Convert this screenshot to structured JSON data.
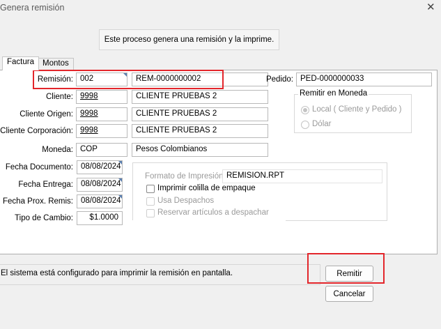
{
  "window": {
    "title": "Genera remisión",
    "close": "✕"
  },
  "info_message": "Este proceso genera una remisión y la imprime.",
  "tabs": [
    {
      "label": "Factura"
    },
    {
      "label": "Montos"
    }
  ],
  "form": {
    "remision": {
      "label": "Remisión:",
      "code": "002",
      "value": "REM-0000000002"
    },
    "pedido": {
      "label": "Pedido:",
      "value": "PED-0000000033"
    },
    "cliente": {
      "label": "Cliente:",
      "code": "9998",
      "name": "CLIENTE PRUEBAS 2"
    },
    "cliente_origen": {
      "label": "Cliente Origen:",
      "code": "9998",
      "name": "CLIENTE PRUEBAS 2"
    },
    "cliente_corporacion": {
      "label": "Cliente Corporación:",
      "code": "9998",
      "name": "CLIENTE PRUEBAS 2"
    },
    "moneda": {
      "label": "Moneda:",
      "code": "COP",
      "name": "Pesos Colombianos"
    },
    "fecha_documento": {
      "label": "Fecha Documento:",
      "value": "08/08/2024"
    },
    "fecha_entrega": {
      "label": "Fecha Entrega:",
      "value": "08/08/2024"
    },
    "fecha_prox_remis": {
      "label": "Fecha Prox. Remis:",
      "value": "08/08/2024"
    },
    "tipo_cambio": {
      "label": "Tipo de Cambio:",
      "value": "$1.0000"
    }
  },
  "remitir_moneda": {
    "title": "Remitir en Moneda",
    "options": [
      {
        "label": "Local ( Cliente y Pedido )",
        "selected": true
      },
      {
        "label": "Dólar",
        "selected": false
      }
    ]
  },
  "impresion": {
    "formato_label": "Formato de Impresión:",
    "formato_value": "REMISION.RPT",
    "checkboxes": [
      {
        "label": "Imprimir colilla de empaque",
        "enabled": true,
        "checked": false
      },
      {
        "label": "Usa Despachos",
        "enabled": false,
        "checked": false
      },
      {
        "label": "Reservar artículos a despachar",
        "enabled": false,
        "checked": false
      }
    ]
  },
  "status_message": "El sistema está configurado para imprimir la remisión en pantalla.",
  "buttons": {
    "remitir": "Remitir",
    "cancelar": "Cancelar"
  },
  "colors": {
    "highlight": "#e3262b",
    "accent_corner": "#5a7fb0"
  }
}
